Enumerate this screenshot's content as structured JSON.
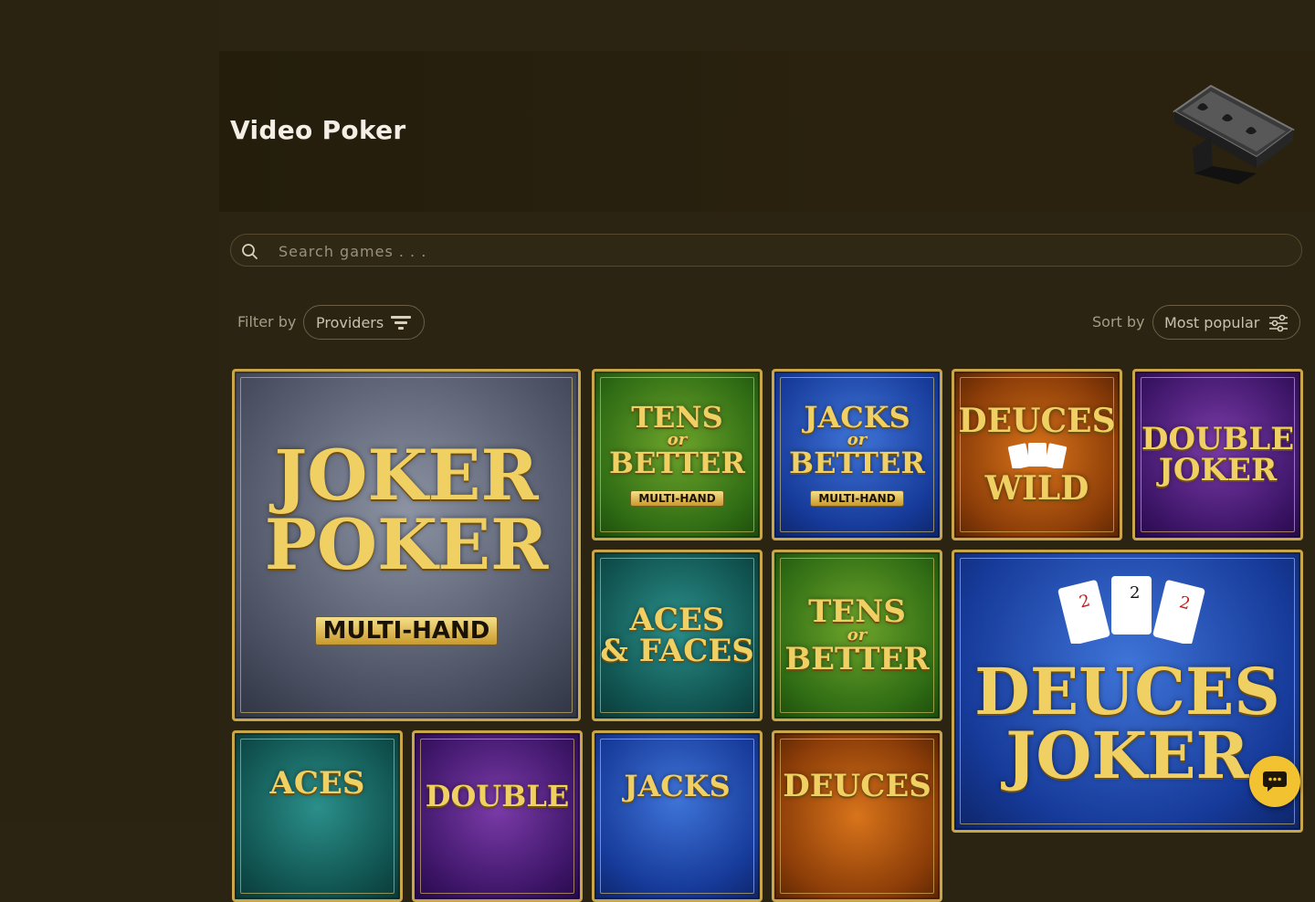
{
  "page": {
    "title": "Video Poker",
    "hero_icon": "poker-chip-cards-icon"
  },
  "search": {
    "placeholder": "Search games . . .",
    "icon": "search-icon"
  },
  "filter": {
    "label": "Filter by",
    "button_label": "Providers",
    "icon": "filter-funnel-icon"
  },
  "sort": {
    "label": "Sort by",
    "button_label": "Most popular",
    "icon": "sliders-icon"
  },
  "games": [
    {
      "line1": "JOKER",
      "line2": "POKER",
      "ribbon": "MULTI-HAND",
      "theme": "grey"
    },
    {
      "line1": "TENS",
      "line2": "BETTER",
      "ribbon": "MULTI-HAND",
      "connector": "or",
      "theme": "green"
    },
    {
      "line1": "JACKS",
      "line2": "BETTER",
      "ribbon": "MULTI-HAND",
      "connector": "or",
      "theme": "blue"
    },
    {
      "line1": "DEUCES",
      "line2": "WILD",
      "theme": "orange"
    },
    {
      "line1": "DOUBLE",
      "line2": "JOKER",
      "theme": "purple"
    },
    {
      "line1": "ACES",
      "line2": "& FACES",
      "theme": "teal"
    },
    {
      "line1": "TENS",
      "line2": "BETTER",
      "connector": "or",
      "theme": "green"
    },
    {
      "line1": "DEUCES",
      "line2": "JOKER",
      "theme": "blue"
    },
    {
      "line1": "ACES",
      "line2": "",
      "theme": "teal"
    },
    {
      "line1": "DOUBLE",
      "line2": "",
      "theme": "purple"
    },
    {
      "line1": "JACKS",
      "line2": "",
      "theme": "blue"
    },
    {
      "line1": "DEUCES",
      "line2": "",
      "theme": "orange"
    }
  ],
  "chat": {
    "icon": "chat-bubble-icon"
  },
  "colors": {
    "background": "#2b2412",
    "accent": "#f2c230",
    "gold": "#f0cf63"
  }
}
